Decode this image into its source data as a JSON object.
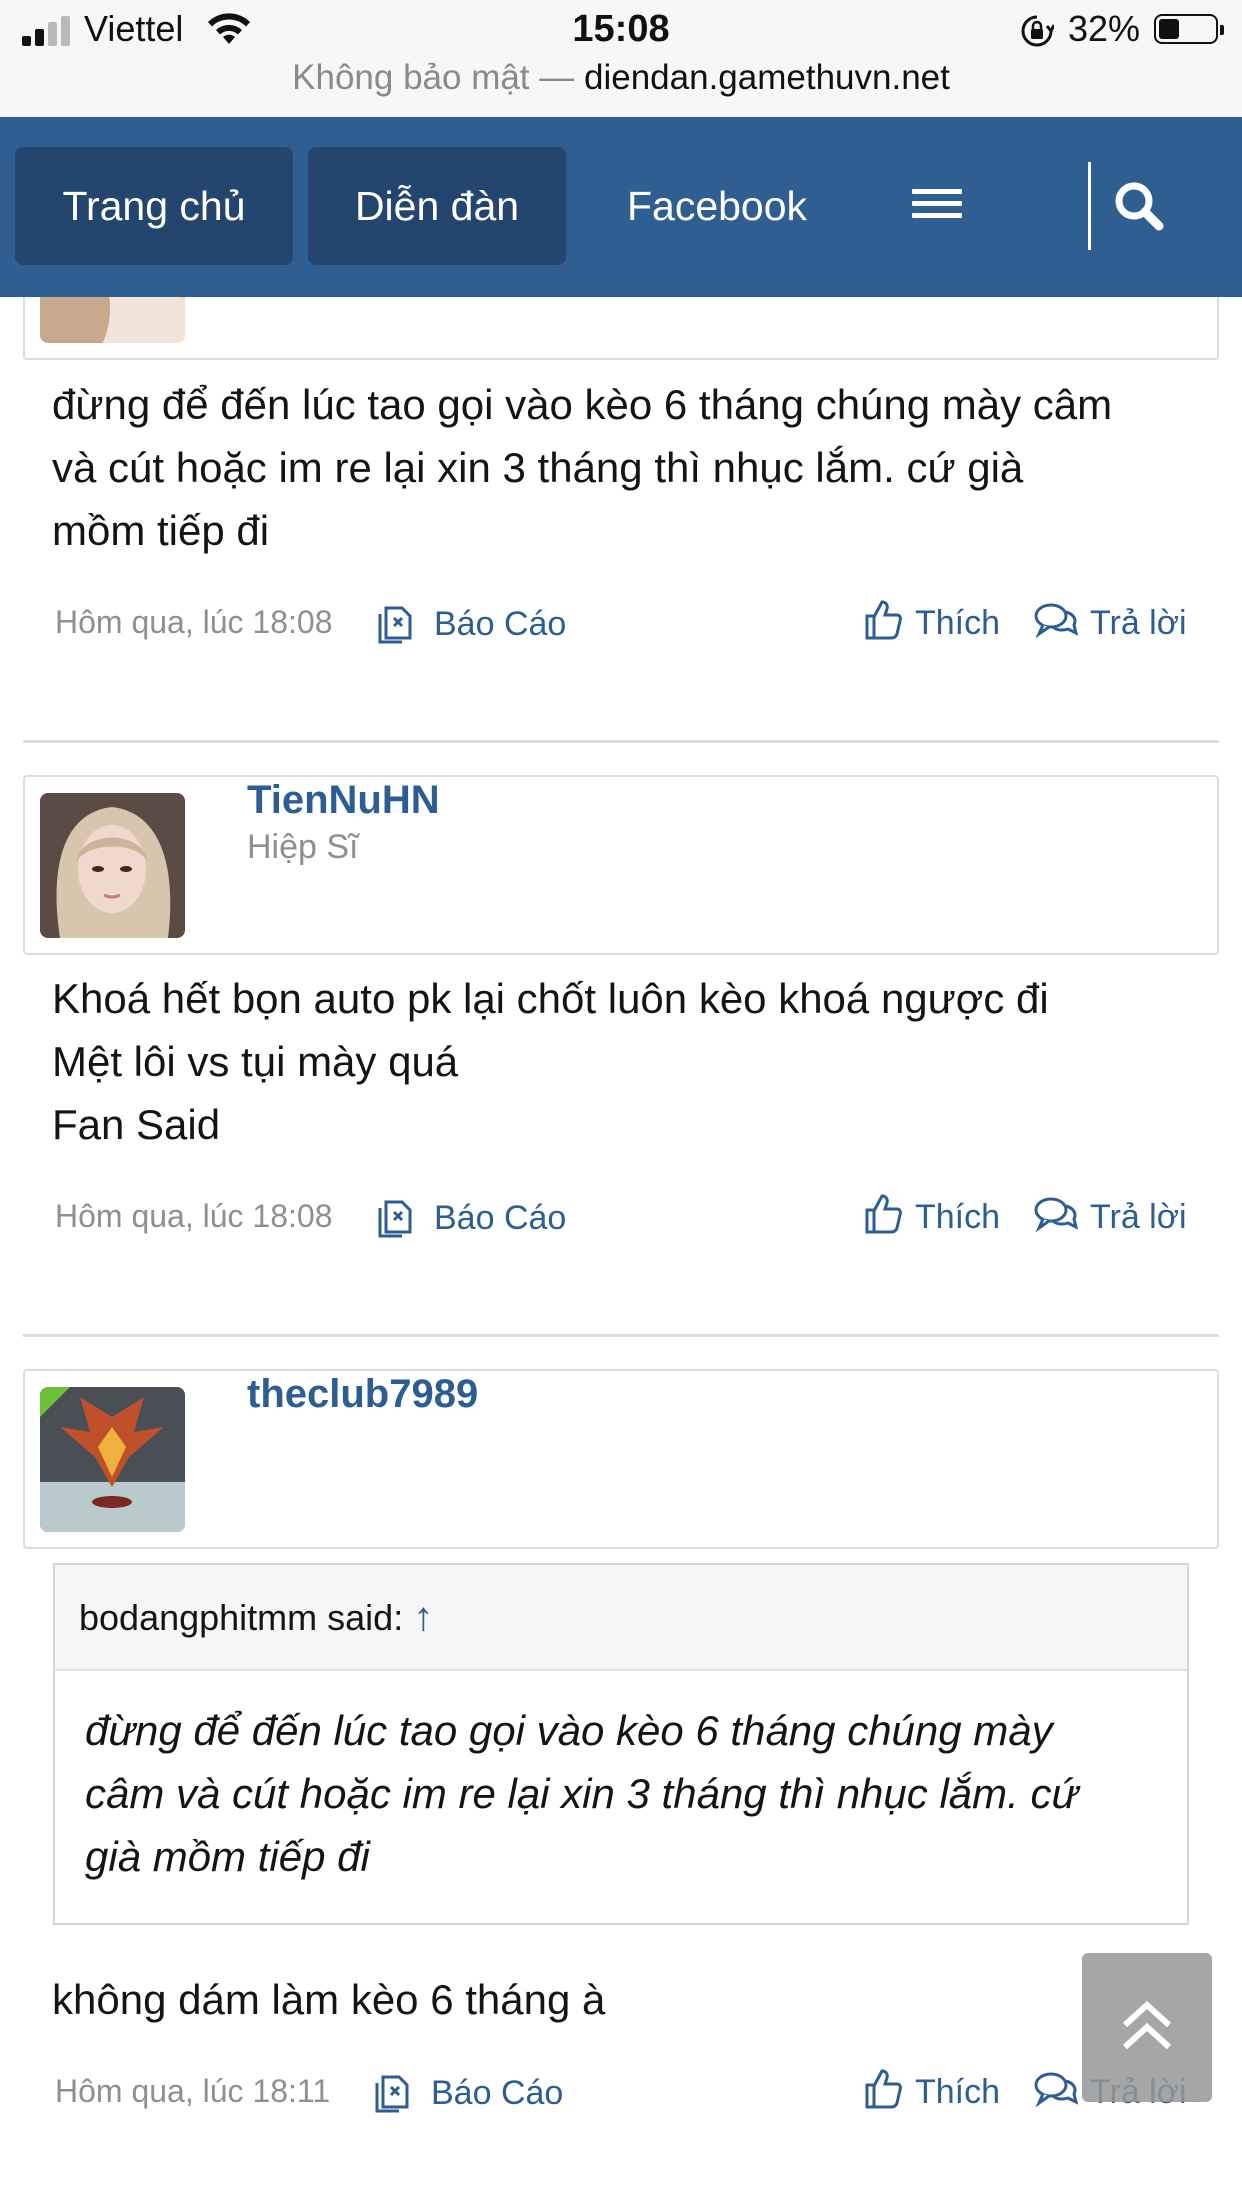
{
  "status_bar": {
    "carrier": "Viettel",
    "time": "15:08",
    "battery_percent": "32%",
    "security_label": "Không bảo mật —",
    "domain": "diendan.gamethuvn.net"
  },
  "nav": {
    "tabs": [
      {
        "label": "Trang chủ",
        "active": true
      },
      {
        "label": "Diễn đàn",
        "active": true
      },
      {
        "label": "Facebook",
        "active": false
      }
    ],
    "menu_icon": "hamburger-icon",
    "search_icon": "search-icon",
    "color": "#2f5e91"
  },
  "actions": {
    "report": "Báo Cáo",
    "like": "Thích",
    "reply": "Trả lời"
  },
  "posts": [
    {
      "message_lines": [
        "đừng để đến lúc tao gọi vào kèo 6 tháng chúng mày câm",
        "và cút hoặc im re lại xin 3 tháng thì nhục lắm. cứ già",
        "mồm tiếp đi"
      ],
      "time": "Hôm qua, lúc 18:08"
    },
    {
      "username": "TienNuHN",
      "user_title": "Hiệp Sĩ",
      "message_lines": [
        "Khoá hết bọn auto pk lại chốt luôn kèo khoá ngược đi",
        "Mệt lôi vs tụi mày quá",
        "Fan Said"
      ],
      "time": "Hôm qua, lúc 18:08"
    },
    {
      "username": "theclub7989",
      "quote": {
        "author": "bodangphitmm said:",
        "arrow": "↑",
        "lines": [
          "đừng để đến lúc tao gọi vào kèo 6 tháng chúng mày",
          "câm và cút hoặc im re lại xin 3 tháng thì nhục lắm. cứ",
          "già mồm tiếp đi"
        ]
      },
      "message_lines": [
        "không dám làm kèo 6 tháng à"
      ],
      "time": "Hôm qua, lúc 18:11"
    }
  ],
  "scroll_top_icon": "double-chevron-up-icon"
}
